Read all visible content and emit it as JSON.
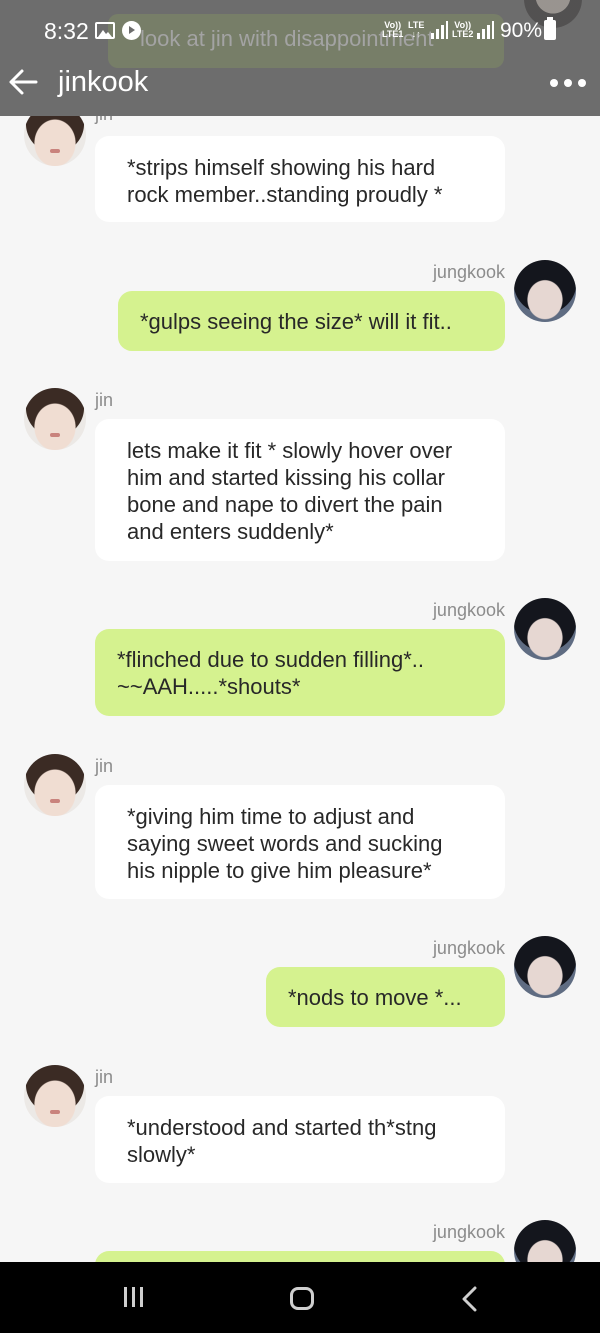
{
  "status_bar": {
    "time": "8:32",
    "net1_top": "Vo))",
    "net1_bottom": "LTE1",
    "net_lte": "LTE",
    "net2_top": "Vo))",
    "net2_bottom": "LTE2",
    "battery": "90%"
  },
  "header": {
    "title": "jinkook",
    "overlap_text": "look at jin with disappointment"
  },
  "messages": [
    {
      "sender": "jin",
      "side": "left",
      "text": "*strips himself showing his hard rock member..standing proudly *"
    },
    {
      "sender": "jungkook",
      "side": "right",
      "text": "*gulps seeing the size* will it fit.."
    },
    {
      "sender": "jin",
      "side": "left",
      "text": "lets make it fit * slowly hover over him and started kissing his collar bone and nape to divert the pain and enters suddenly*"
    },
    {
      "sender": "jungkook",
      "side": "right",
      "text": "*flinched due to sudden filling*..\n~~AAH.....*shouts*"
    },
    {
      "sender": "jin",
      "side": "left",
      "text": "*giving him time to adjust and saying sweet words and sucking his nipple to give him pleasure*"
    },
    {
      "sender": "jungkook",
      "side": "right",
      "text": "*nods to move *..."
    },
    {
      "sender": "jin",
      "side": "left",
      "text": "*understood and started th*stng slowly*"
    },
    {
      "sender": "jungkook",
      "side": "right",
      "text": ""
    }
  ],
  "colors": {
    "header_bg": "#6d6d6d",
    "jin_bubble": "#ffffff",
    "jungkook_bubble": "#d5f28f",
    "background": "#f6f6f6",
    "sender_name": "#8c8c8c"
  },
  "icons": {
    "back": "arrow-left-icon",
    "more": "more-dots-icon",
    "nav_recent": "recent-apps-icon",
    "nav_home": "home-icon",
    "nav_back": "chevron-left-icon"
  }
}
